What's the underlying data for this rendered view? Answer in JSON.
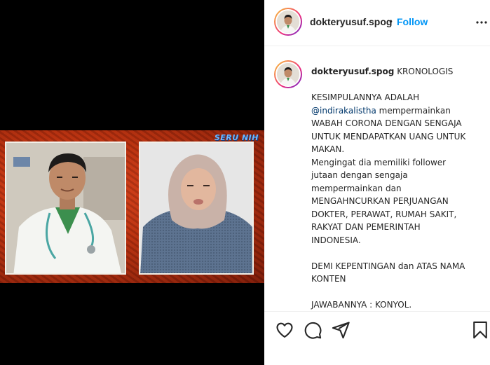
{
  "post": {
    "username": "dokteryusuf.spog",
    "follow_label": "Follow",
    "separator": "•",
    "media": {
      "watermark": "SERU NIH"
    },
    "caption": {
      "username": "dokteryusuf.spog",
      "first_line": "KRONOLOGIS",
      "lines": [
        "",
        "KESIMPULANNYA ADALAH",
        "@indirakalistha mempermainkan",
        "WABAH CORONA DENGAN SENGAJA",
        "UNTUK MENDAPATKAN UANG UNTUK",
        "MAKAN.",
        "Mengingat dia memiliki follower",
        "jutaan dengan sengaja",
        "mempermainkan dan",
        "MENGAHNCURKAN PERJUANGAN",
        "DOKTER, PERAWAT, RUMAH SAKIT,",
        "RAKYAT DAN PEMERINTAH",
        "INDONESIA.",
        "",
        "DEMI KEPENTINGAN dan ATAS NAMA",
        "KONTEN",
        "",
        "JAWABANNYA : KONYOL."
      ]
    },
    "icons": {
      "like": "heart-icon",
      "comment": "comment-icon",
      "share": "share-icon",
      "save": "bookmark-icon",
      "more": "more-icon"
    },
    "colors": {
      "link": "#0095f6",
      "text": "#262626",
      "mention": "#00376b"
    }
  }
}
